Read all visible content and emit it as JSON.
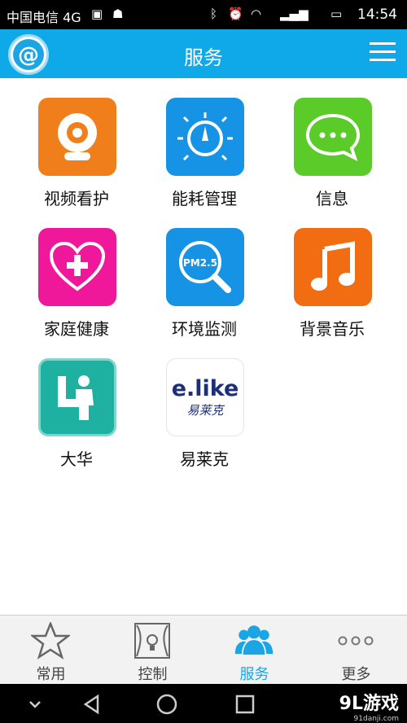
{
  "status_bar": {
    "carrier": "中国电信 4G",
    "time": "14:54",
    "icons": [
      "sim-icon",
      "android-debug-icon",
      "bluetooth-icon",
      "alarm-icon",
      "wifi-icon",
      "signal-icon",
      "battery-icon"
    ]
  },
  "header": {
    "title": "服务",
    "logo_icon": "app-logo-icon",
    "menu_icon": "hamburger-icon"
  },
  "services": [
    {
      "label": "视频看护",
      "icon": "camera-icon",
      "color": "#f07e1b"
    },
    {
      "label": "能耗管理",
      "icon": "energy-gauge-icon",
      "color": "#1793e5"
    },
    {
      "label": "信息",
      "icon": "message-icon",
      "color": "#5acb29"
    },
    {
      "label": "家庭健康",
      "icon": "heart-plus-icon",
      "color": "#f0189a"
    },
    {
      "label": "环境监测",
      "icon": "pm25-magnifier-icon",
      "color": "#1793e5"
    },
    {
      "label": "背景音乐",
      "icon": "music-note-icon",
      "color": "#f26d12"
    },
    {
      "label": "大华",
      "icon": "dahua-logo-icon",
      "color": "#1eb0a0"
    },
    {
      "label": "易莱克",
      "icon": "elike-logo-icon",
      "color": "#ffffff",
      "logo_text": "e.like",
      "logo_subtext": "易莱克"
    }
  ],
  "tabs": [
    {
      "label": "常用",
      "icon": "star-icon",
      "active": false
    },
    {
      "label": "控制",
      "icon": "curtain-bulb-icon",
      "active": false
    },
    {
      "label": "服务",
      "icon": "people-icon",
      "active": true
    },
    {
      "label": "更多",
      "icon": "more-dots-icon",
      "active": false
    }
  ],
  "nav_bar": {
    "icons": [
      "down-chevron-icon",
      "back-icon",
      "home-icon",
      "recents-icon"
    ]
  },
  "watermark": {
    "text": "9L游戏",
    "subtext": "91danji.com"
  },
  "colors": {
    "accent": "#0fa9ea",
    "tabbar": "#f2f2f2"
  }
}
